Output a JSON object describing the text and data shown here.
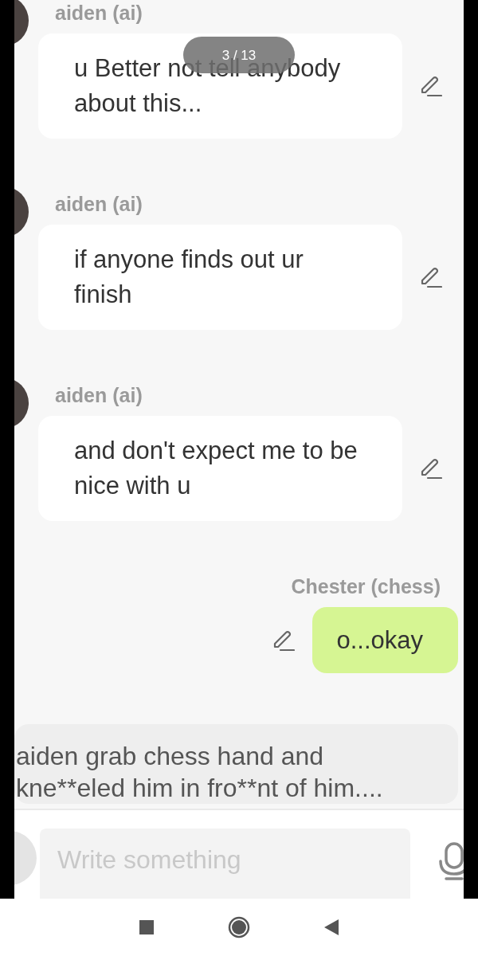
{
  "page_counter": "3 / 13",
  "messages": [
    {
      "kind": "received",
      "sender": "aiden (ai)",
      "text": "u Better not tell anybody about this..."
    },
    {
      "kind": "received",
      "sender": "aiden (ai)",
      "text": "if anyone finds out ur finish"
    },
    {
      "kind": "received",
      "sender": "aiden (ai)",
      "text": "and don't expect me to be nice with u"
    },
    {
      "kind": "sent",
      "sender": "Chester (chess)",
      "text": "o...okay"
    }
  ],
  "draft": {
    "text": "aiden grab chess hand and kne**eled him in fro**nt of him...."
  },
  "composer": {
    "placeholder": "Write something"
  }
}
